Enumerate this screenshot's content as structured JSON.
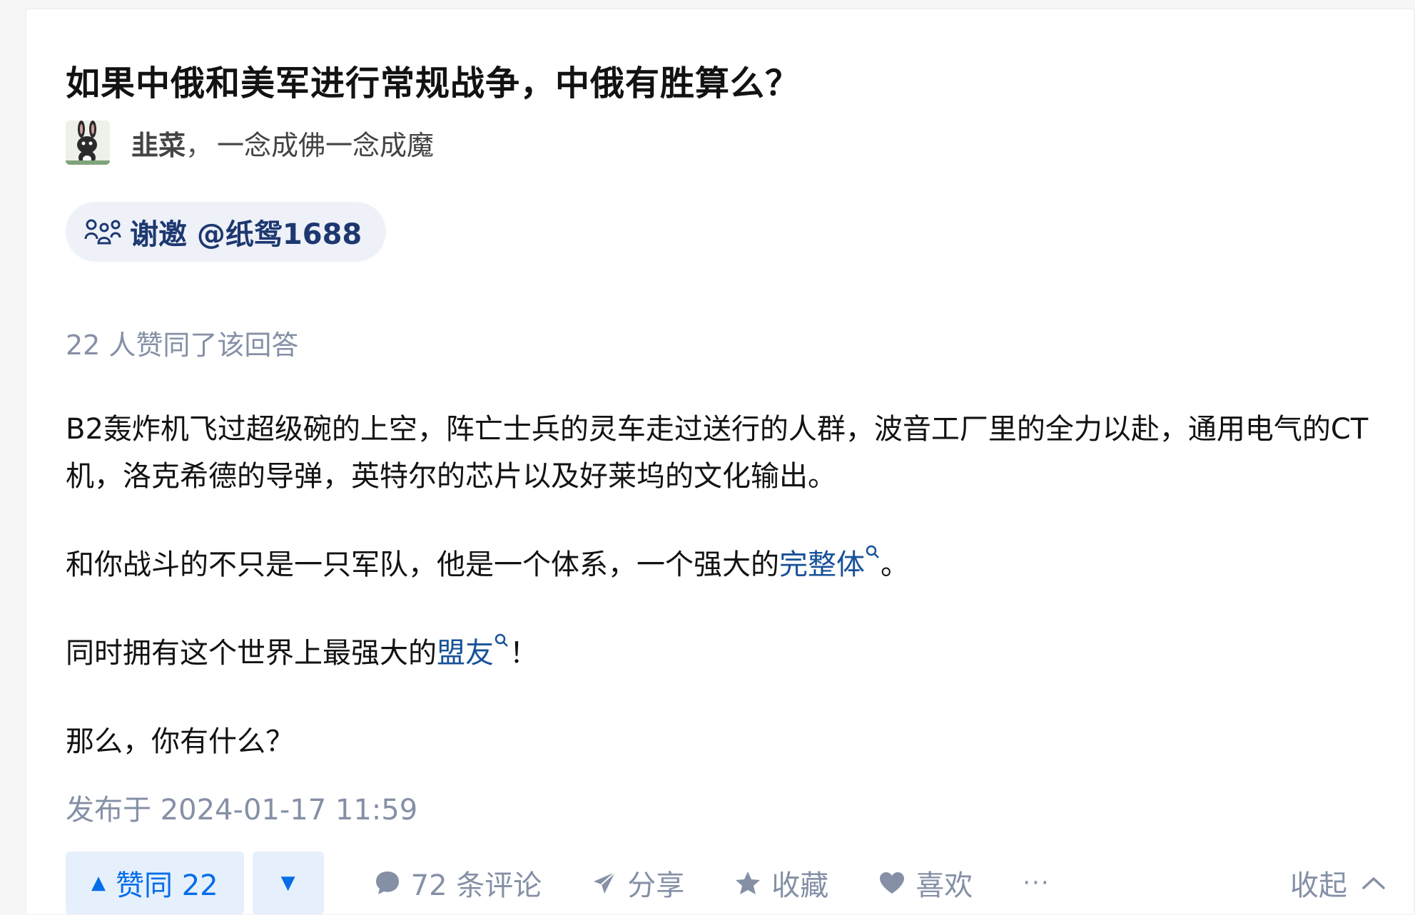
{
  "question": {
    "title": "如果中俄和美军进行常规战争，中俄有胜算么？"
  },
  "author": {
    "name": "韭菜",
    "separator": "，",
    "bio": "一念成佛一念成魔",
    "avatar_icon": "bunny-avatar-icon"
  },
  "invite": {
    "icon": "people-invite-icon",
    "text": "谢邀 @纸鸳1688"
  },
  "answer": {
    "vote_summary": "22 人赞同了该回答",
    "paragraph1": "B2轰炸机飞过超级碗的上空，阵亡士兵的灵车走过送行的人群，波音工厂里的全力以赴，通用电气的CT机，洛克希德的导弹，英特尔的芯片以及好莱坞的文化输出。",
    "paragraph2_before": "和你战斗的不只是一只军队，他是一个体系，一个强大的",
    "paragraph2_link": "完整体",
    "paragraph2_after": "。",
    "paragraph3_before": "同时拥有这个世界上最强大的",
    "paragraph3_link": "盟友",
    "paragraph3_after": "！",
    "paragraph4": "那么，你有什么？",
    "published": "发布于 2024-01-17 11:59"
  },
  "actions": {
    "upvote_label": "赞同 22",
    "downvote_icon": "triangle-down-icon",
    "comments_label": "72 条评论",
    "share_label": "分享",
    "favorite_label": "收藏",
    "like_label": "喜欢",
    "more_label": "···",
    "collapse_label": "收起"
  },
  "colors": {
    "link": "#175199",
    "accent_blue": "#056de8",
    "muted_gray": "#8590a6",
    "invite_bg": "#eef1f8"
  }
}
